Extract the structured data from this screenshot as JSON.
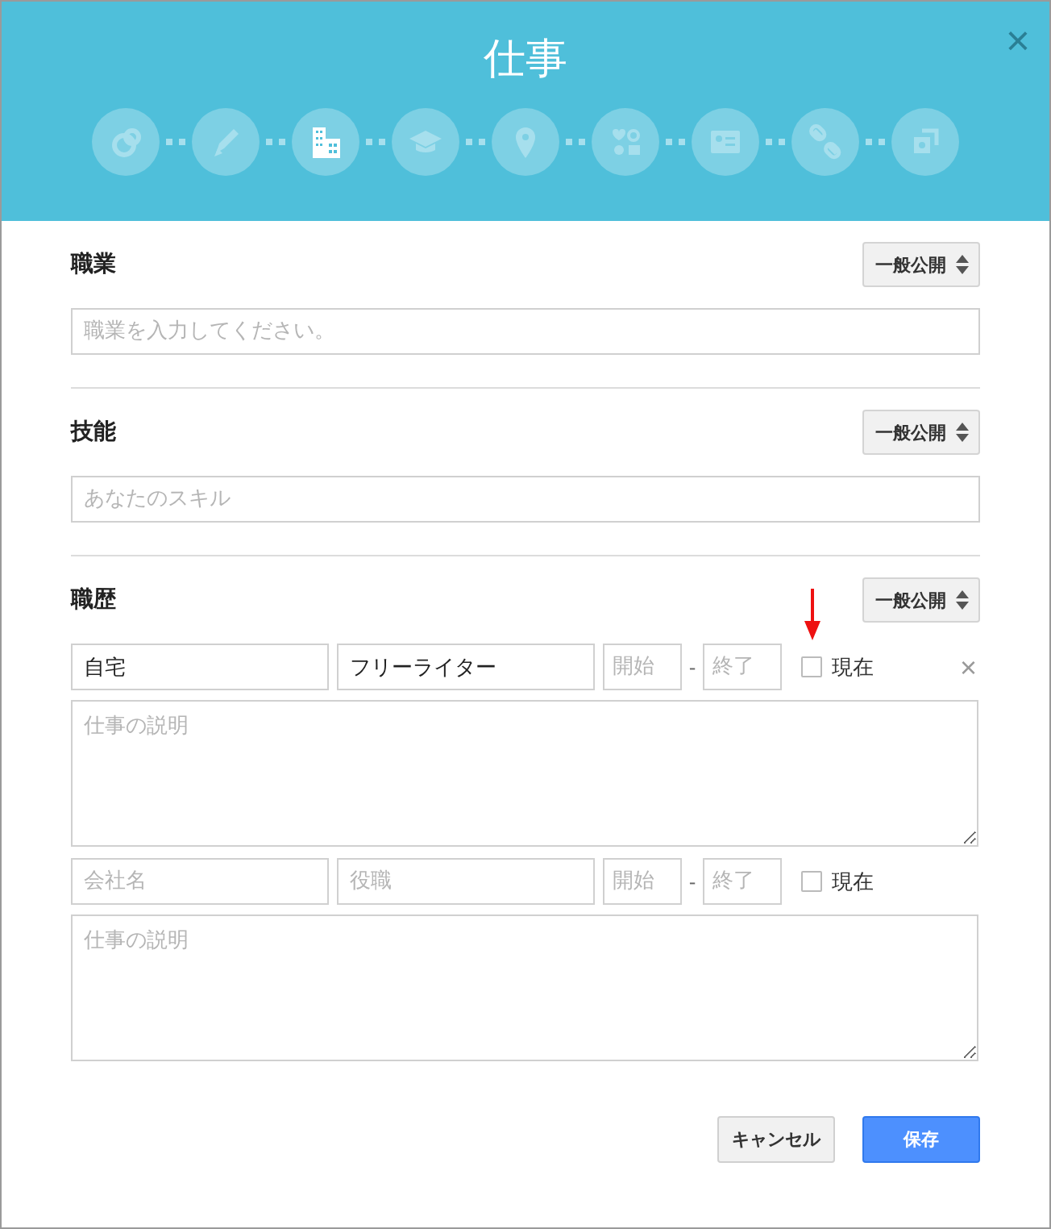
{
  "dialog": {
    "title": "仕事",
    "close": "×"
  },
  "steps": [
    {
      "kind": "circles",
      "selected": false
    },
    {
      "kind": "pencil",
      "selected": false
    },
    {
      "kind": "building",
      "selected": true
    },
    {
      "kind": "cap",
      "selected": false
    },
    {
      "kind": "pin",
      "selected": false
    },
    {
      "kind": "symbols",
      "selected": false
    },
    {
      "kind": "card",
      "selected": false
    },
    {
      "kind": "link",
      "selected": false
    },
    {
      "kind": "window",
      "selected": false
    }
  ],
  "sections": [
    {
      "kind": "field",
      "label": "職業",
      "privacy": "一般公開",
      "placeholder": "職業を入力してください。"
    },
    {
      "kind": "field",
      "label": "技能",
      "privacy": "一般公開",
      "placeholder": "あなたのスキル"
    },
    {
      "kind": "history",
      "label": "職歴",
      "privacy": "一般公開",
      "entries": [
        {
          "company": {
            "value": "自宅"
          },
          "position": {
            "value": "フリーライター"
          },
          "start": {
            "placeholder": "開始"
          },
          "end": {
            "placeholder": "終了"
          },
          "separator": "-",
          "current": {
            "label": "現在",
            "checked": false
          },
          "description": {
            "placeholder": "仕事の説明"
          },
          "remove": "×",
          "highlighted": true
        },
        {
          "company": {
            "placeholder": "会社名"
          },
          "position": {
            "placeholder": "役職"
          },
          "start": {
            "placeholder": "開始"
          },
          "end": {
            "placeholder": "終了"
          },
          "separator": "-",
          "current": {
            "label": "現在",
            "checked": false
          },
          "description": {
            "placeholder": "仕事の説明"
          },
          "highlighted": false
        }
      ]
    }
  ],
  "buttons": [
    {
      "kind": "secondary",
      "label": "キャンセル"
    },
    {
      "kind": "primary",
      "label": "保存"
    }
  ]
}
